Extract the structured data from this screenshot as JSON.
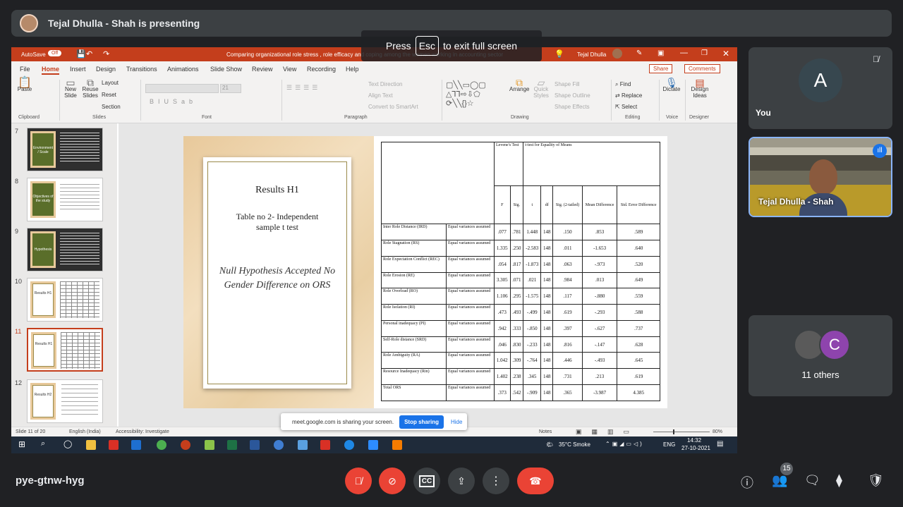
{
  "topbar": {
    "presenting_text": "Tejal Dhulla - Shah is presenting"
  },
  "fullscreen_toast": {
    "press": "Press",
    "key": "Esc",
    "suffix": "to exit full screen"
  },
  "powerpoint": {
    "autosave_label": "AutoSave",
    "autosave_state": "Off",
    "doc_title": "Comparing organizational role stress , role efficacy and coping among the women working in accounting sector",
    "user_name": "Tejal Dhulla",
    "menu": [
      "File",
      "Home",
      "Insert",
      "Design",
      "Transitions",
      "Animations",
      "Slide Show",
      "Review",
      "View",
      "Recording",
      "Help"
    ],
    "share_label": "Share",
    "comments_label": "Comments",
    "ribbon": {
      "paste": "Paste",
      "new_slide": "New Slide",
      "reuse_slides": "Reuse Slides",
      "layout": "Layout",
      "reset": "Reset",
      "section": "Section",
      "font_size": "21",
      "text_direction": "Text Direction",
      "align_text": "Align Text",
      "convert_smartart": "Convert to SmartArt",
      "arrange": "Arrange",
      "quick_styles": "Quick Styles",
      "shape_fill": "Shape Fill",
      "shape_outline": "Shape Outline",
      "shape_effects": "Shape Effects",
      "find": "Find",
      "replace": "Replace",
      "select": "Select",
      "dictate": "Dictate",
      "design_ideas": "Design Ideas",
      "groups": [
        "Clipboard",
        "Slides",
        "Font",
        "Paragraph",
        "Drawing",
        "Editing",
        "Voice",
        "Designer"
      ]
    },
    "thumbnails": [
      {
        "num": "7",
        "title": "Environment / Scale"
      },
      {
        "num": "8",
        "title": "Objectives of the study"
      },
      {
        "num": "9",
        "title": "Hypothesis"
      },
      {
        "num": "10",
        "title": "Results H1"
      },
      {
        "num": "11",
        "title": "Results H1"
      },
      {
        "num": "12",
        "title": "Results H2"
      }
    ],
    "slide": {
      "title": "Results H1",
      "caption": "Table no 2- Independent sample t test",
      "null_hypothesis": "Null Hypothesis Accepted No Gender Difference on ORS",
      "table": {
        "levene_header": "Levene's Test",
        "ttest_header": "t-test for Equality of Means",
        "col_headers": [
          "F",
          "Sig.",
          "t",
          "df",
          "Sig. (2-tailed)",
          "Mean Difference",
          "Std. Error Difference"
        ],
        "rows": [
          {
            "name": "Inter Role Distance (IRD)",
            "assume": "Equal variances assumed",
            "vals": [
              ".077",
              ".781",
              "1.448",
              "148",
              ".150",
              ".853",
              ".589"
            ]
          },
          {
            "name": "Role Stagnation (RS)",
            "assume": "Equal variances assumed",
            "vals": [
              "1.335",
              ".250",
              "-2.583",
              "148",
              ".011",
              "-1.653",
              ".640"
            ]
          },
          {
            "name": "Role Expectation Conflict (REC)",
            "assume": "Equal variances assumed",
            "vals": [
              ".054",
              ".817",
              "-1.873",
              "148",
              ".063",
              "-.973",
              ".520"
            ]
          },
          {
            "name": "Role Erosion (RE)",
            "assume": "Equal variances assumed",
            "vals": [
              "3.305",
              ".071",
              ".021",
              "148",
              ".984",
              ".013",
              ".649"
            ]
          },
          {
            "name": "Role Overload (RO)",
            "assume": "Equal variances assumed",
            "vals": [
              "1.106",
              ".295",
              "-1.575",
              "148",
              ".117",
              "-.880",
              ".559"
            ]
          },
          {
            "name": "Role Isolation (RI)",
            "assume": "Equal variances assumed",
            "vals": [
              ".473",
              ".493",
              "-.499",
              "148",
              ".619",
              "-.293",
              ".588"
            ]
          },
          {
            "name": "Personal inadequacy (PI)",
            "assume": "Equal variances assumed",
            "vals": [
              ".942",
              ".333",
              "-.850",
              "148",
              ".397",
              "-.627",
              ".737"
            ]
          },
          {
            "name": "Self-Role distance (SRD)",
            "assume": "Equal variances assumed",
            "vals": [
              ".046",
              ".830",
              "-.233",
              "148",
              ".816",
              "-.147",
              ".628"
            ]
          },
          {
            "name": "Role Ambiguity (RA)",
            "assume": "Equal variances assumed",
            "vals": [
              "1.042",
              ".309",
              "-.764",
              "148",
              ".446",
              "-.493",
              ".645"
            ]
          },
          {
            "name": "Resource Inadequacy (Rin)",
            "assume": "Equal variances assumed",
            "vals": [
              "1.402",
              ".238",
              ".345",
              "148",
              ".731",
              ".213",
              ".619"
            ]
          },
          {
            "name": "Total ORS",
            "assume": "Equal variances assumed",
            "vals": [
              ".373",
              ".542",
              "-.909",
              "148",
              ".365",
              "-3.987",
              "4.385"
            ]
          }
        ]
      }
    },
    "status": {
      "slide_of": "Slide 11 of 20",
      "language": "English (India)",
      "accessibility": "Accessibility: Investigate",
      "notes": "Notes",
      "zoom": "80%"
    }
  },
  "taskbar": {
    "weather": "35°C Smoke",
    "lang": "ENG",
    "time": "14:32",
    "date": "27-10-2021"
  },
  "sharing_bar": {
    "message": "meet.google.com is sharing your screen.",
    "stop": "Stop sharing",
    "hide": "Hide"
  },
  "participants": {
    "you": {
      "initial": "A",
      "name": "You"
    },
    "presenter": {
      "name": "Tejal Dhulla - Shah"
    },
    "others": {
      "initial": "C",
      "label": "11 others"
    }
  },
  "meeting": {
    "code": "pye-gtnw-hyg",
    "people_count": "15"
  }
}
